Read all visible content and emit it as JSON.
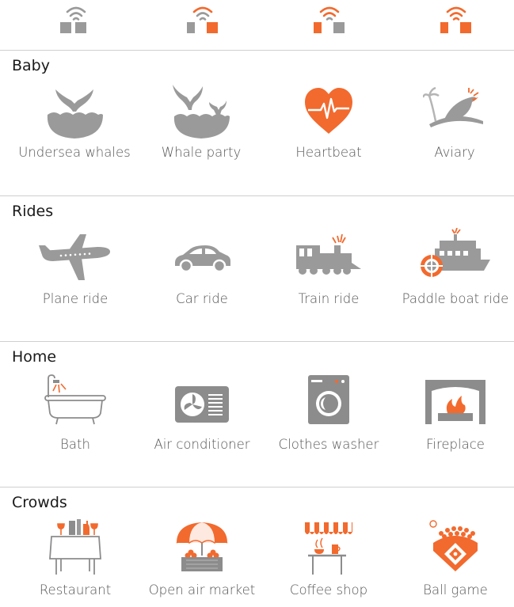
{
  "colors": {
    "accent": "#f26a2e",
    "gray": "#9a9a9a",
    "text": "#555555",
    "heading": "#1a1a1a"
  },
  "volume_levels": [
    {
      "icon": "wifi-gray-icon",
      "level": 0
    },
    {
      "icon": "wifi-low-icon",
      "level": 1
    },
    {
      "icon": "wifi-mid-icon",
      "level": 2
    },
    {
      "icon": "wifi-high-icon",
      "level": 3
    }
  ],
  "sections": [
    {
      "title": "Baby",
      "items": [
        {
          "label": "Undersea whales",
          "icon": "whale-tail-icon"
        },
        {
          "label": "Whale party",
          "icon": "whale-party-icon"
        },
        {
          "label": "Heartbeat",
          "icon": "heartbeat-icon"
        },
        {
          "label": "Aviary",
          "icon": "bird-icon"
        }
      ]
    },
    {
      "title": "Rides",
      "items": [
        {
          "label": "Plane ride",
          "icon": "plane-icon"
        },
        {
          "label": "Car ride",
          "icon": "car-icon"
        },
        {
          "label": "Train ride",
          "icon": "train-icon"
        },
        {
          "label": "Paddle boat ride",
          "icon": "paddle-boat-icon"
        }
      ]
    },
    {
      "title": "Home",
      "items": [
        {
          "label": "Bath",
          "icon": "bathtub-icon"
        },
        {
          "label": "Air conditioner",
          "icon": "air-conditioner-icon"
        },
        {
          "label": "Clothes washer",
          "icon": "washing-machine-icon"
        },
        {
          "label": "Fireplace",
          "icon": "fireplace-icon"
        }
      ]
    },
    {
      "title": "Crowds",
      "items": [
        {
          "label": "Restaurant",
          "icon": "restaurant-table-icon"
        },
        {
          "label": "Open air market",
          "icon": "market-stall-icon"
        },
        {
          "label": "Coffee shop",
          "icon": "coffee-shop-icon"
        },
        {
          "label": "Ball game",
          "icon": "ballpark-icon"
        }
      ]
    }
  ]
}
